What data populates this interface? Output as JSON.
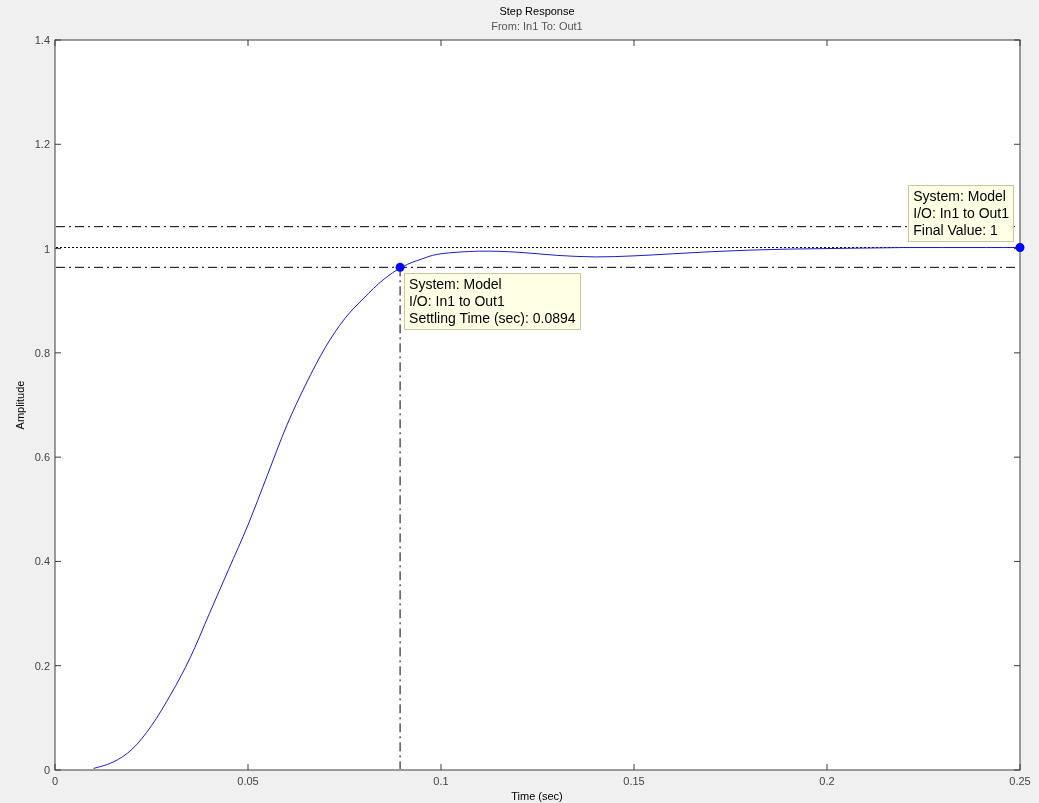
{
  "figure": {
    "subtitle": "From: In1  To: Out1",
    "chart_data": {
      "type": "line",
      "title": "Step Response",
      "xlabel": "Time (sec)",
      "ylabel": "Amplitude",
      "xlim": [
        0,
        0.25
      ],
      "ylim": [
        0,
        1.4
      ],
      "xticks": [
        0,
        0.05,
        0.1,
        0.15,
        0.2,
        0.25
      ],
      "yticks": [
        0,
        0.2,
        0.4,
        0.6,
        0.8,
        1,
        1.2,
        1.4
      ],
      "x": [
        0.01,
        0.015,
        0.02,
        0.025,
        0.03,
        0.035,
        0.04,
        0.045,
        0.05,
        0.055,
        0.06,
        0.065,
        0.07,
        0.075,
        0.08,
        0.085,
        0.09,
        0.095,
        0.1,
        0.11,
        0.12,
        0.13,
        0.14,
        0.15,
        0.16,
        0.17,
        0.18,
        0.19,
        0.2,
        0.21,
        0.22,
        0.23,
        0.24,
        0.25
      ],
      "series": [
        {
          "color": "#1c1cc8",
          "values": [
            0.003,
            0.015,
            0.04,
            0.085,
            0.145,
            0.215,
            0.3,
            0.385,
            0.47,
            0.565,
            0.66,
            0.74,
            0.81,
            0.865,
            0.905,
            0.94,
            0.965,
            0.98,
            0.99,
            0.995,
            0.993,
            0.987,
            0.984,
            0.986,
            0.99,
            0.994,
            0.997,
            0.999,
            1.0,
            1.001,
            1.002,
            1.002,
            1.002,
            1.002
          ]
        }
      ]
    },
    "datatips": [
      {
        "lines": [
          "System: Model",
          "I/O: In1 to Out1",
          "Settling Time (sec): 0.0894"
        ]
      },
      {
        "lines": [
          "System: Model",
          "I/O: In1 to Out1",
          "Final Value: 1"
        ]
      }
    ]
  }
}
